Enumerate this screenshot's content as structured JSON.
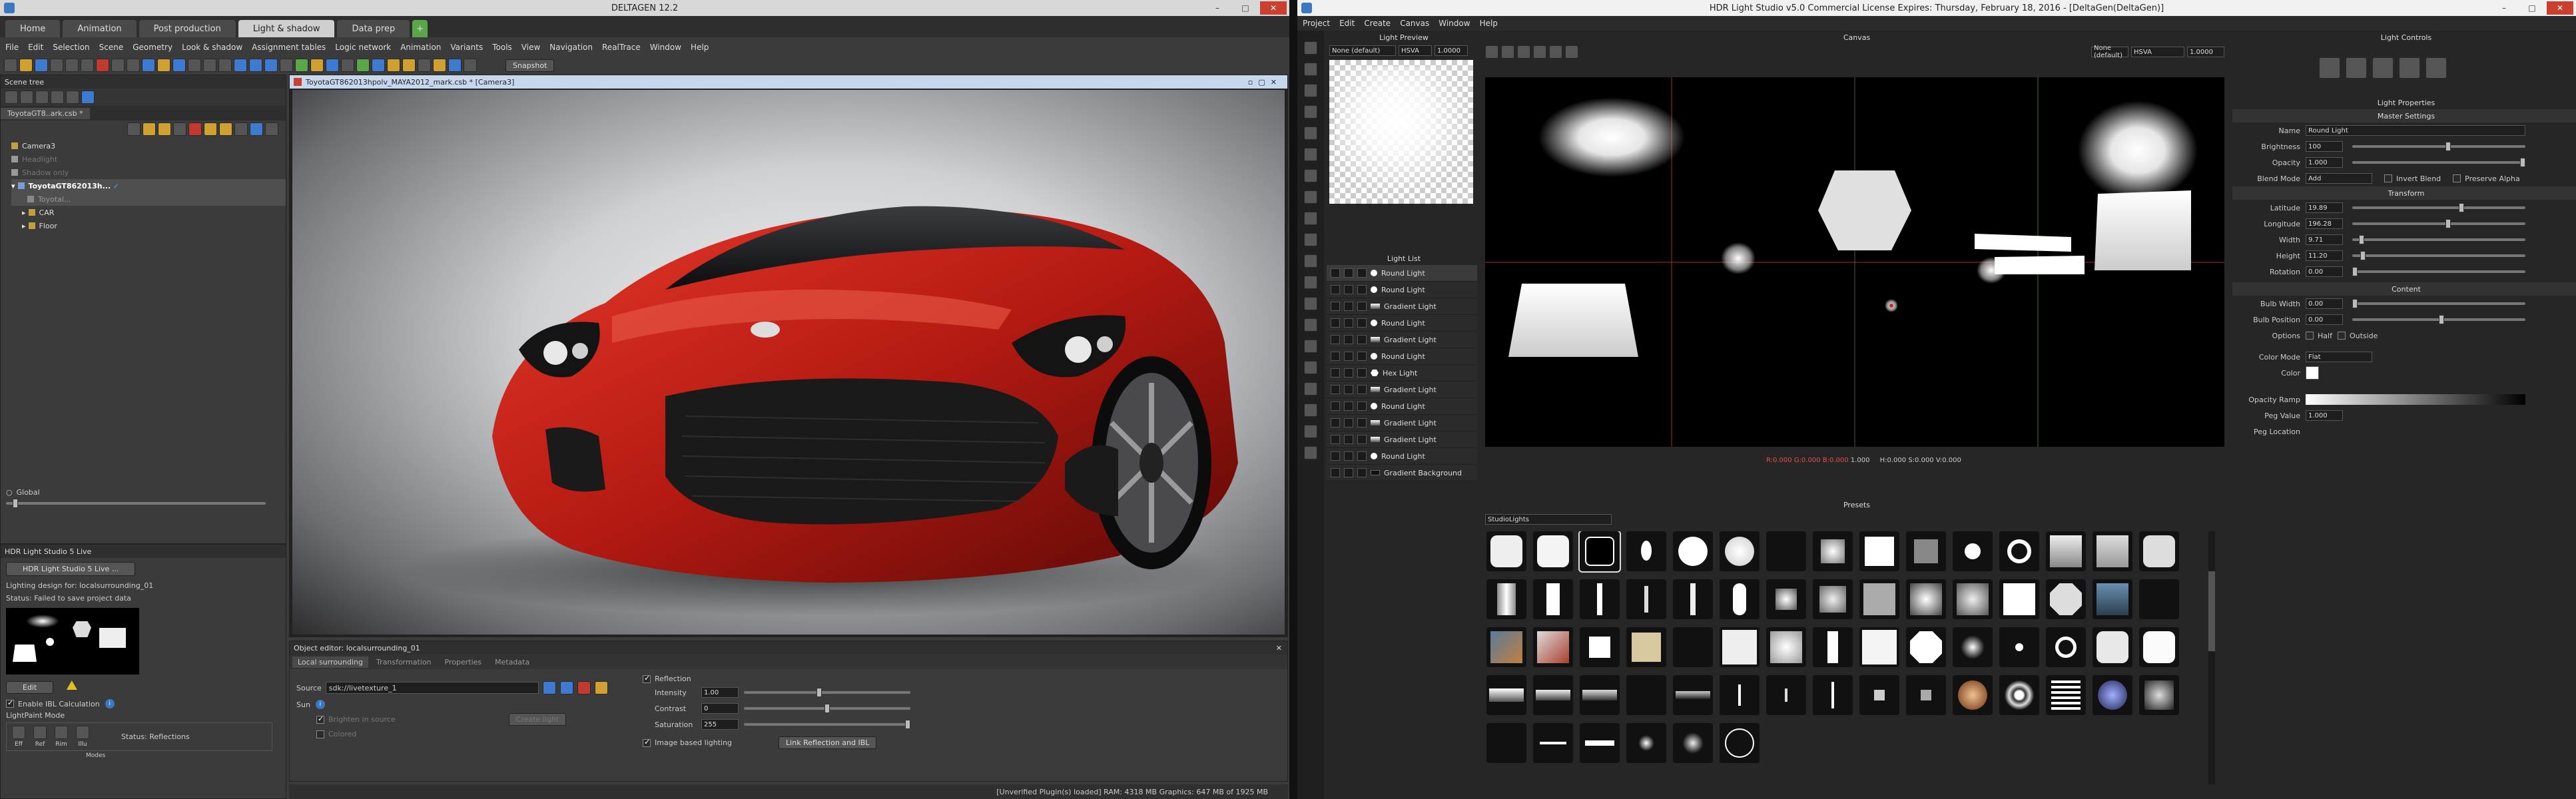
{
  "deltagen": {
    "title": "DELTAGEN 12.2",
    "tabs": [
      "Home",
      "Animation",
      "Post production",
      "Light & shadow",
      "Data prep"
    ],
    "menus": [
      "File",
      "Edit",
      "Selection",
      "Scene",
      "Geometry",
      "Look & shadow",
      "Assignment tables",
      "Logic network",
      "Animation",
      "Variants",
      "Tools",
      "View",
      "Navigation",
      "RealTrace",
      "Window",
      "Help"
    ],
    "snapshot_label": "Snapshot",
    "scene_tree": {
      "header": "Scene tree",
      "file_tab": "ToyotaGT8..ark.csb *",
      "items": [
        "Camera3",
        "Headlight",
        "Shadow only",
        "ToyotaGT862013h...",
        "Toyotal...",
        "CAR",
        "Floor"
      ]
    },
    "global_label": "Global",
    "viewport_title": "ToyotaGT862013hpolv_MAYA2012_mark.csb * [Camera3]",
    "hdr_panel": {
      "header": "HDR Light Studio 5 Live",
      "button": "HDR Light Studio 5 Live ...",
      "design_for": "Lighting design for: localsurrounding_01",
      "status": "Status: Failed to save project data",
      "edit": "Edit",
      "enable_ibl": "Enable IBL Calculation",
      "lightpaint_mode": "LightPaint Mode",
      "modes": [
        "Eff",
        "Ref",
        "Rim",
        "Illu"
      ],
      "status2": "Status: Reflections",
      "modes_footer": "Modes"
    },
    "object_editor": {
      "header": "Object editor: localsurrounding_01",
      "tabs": [
        "Local surrounding",
        "Transformation",
        "Properties",
        "Metadata"
      ],
      "source_label": "Source",
      "source_value": "sdk://livetexture_1",
      "sun_label": "Sun",
      "brighten": "Brighten in source",
      "colored": "Colored",
      "create_light": "Create light",
      "reflection": "Reflection",
      "intensity_label": "Intensity",
      "intensity": "1.00",
      "intensity_level": 0.45,
      "contrast_label": "Contrast",
      "contrast": "0",
      "contrast_level": 0.5,
      "saturation_label": "Saturation",
      "saturation": "255",
      "saturation_level": 1.0,
      "ibl": "Image based lighting",
      "link": "Link Reflection and IBL"
    },
    "statusbar": "[Unverified Plugin(s) loaded]     RAM: 4318 MB Graphics: 647 MB of 1925 MB"
  },
  "hdr": {
    "title": "HDR Light Studio v5.0 Commercial License Expires: Thursday, February 18, 2016 - [DeltaGen(DeltaGen)]",
    "menus": [
      "Project",
      "Edit",
      "Create",
      "Canvas",
      "Window",
      "Help"
    ],
    "preview": {
      "header": "Light Preview",
      "profile": "None (default)",
      "mode": "HSVA",
      "value": "1.0000"
    },
    "light_list": {
      "header": "Light List",
      "items": [
        "Round Light",
        "Round Light",
        "Gradient Light",
        "Round Light",
        "Gradient Light",
        "Round Light",
        "Hex Light",
        "Gradient Light",
        "Round Light",
        "Gradient Light",
        "Gradient Light",
        "Round Light",
        "Gradient Background"
      ]
    },
    "canvas": {
      "header": "Canvas",
      "profile": "None (default)",
      "mode": "HSVA",
      "value": "1.0000",
      "readout_rgb": "R:0.000 G:0.000 B:0.000",
      "readout_a": "1.000",
      "readout_hsv": "H:0.000 S:0.000 V:0.000"
    },
    "presets": {
      "header": "Presets",
      "category": "StudioLights"
    },
    "light_controls": {
      "header": "Light Controls",
      "props_header": "Light Properties",
      "master": "Master Settings",
      "name_label": "Name",
      "name": "Round Light",
      "brightness_label": "Brightness",
      "brightness": "100",
      "opacity_label": "Opacity",
      "opacity": "1.000",
      "blend_label": "Blend Mode",
      "blend": "Add",
      "invert_blend": "Invert Blend",
      "preserve_alpha": "Preserve Alpha",
      "transform": "Transform",
      "latitude_label": "Latitude",
      "latitude": "19.89",
      "longitude_label": "Longitude",
      "longitude": "196.28",
      "width_label": "Width",
      "width": "9.71",
      "height_label": "Height",
      "height": "11.20",
      "rotation_label": "Rotation",
      "rotation": "0.00",
      "content": "Content",
      "bulb_width_label": "Bulb Width",
      "bulb_width": "0.00",
      "bulb_position_label": "Bulb Position",
      "bulb_position": "0.00",
      "options_label": "Options",
      "half": "Half",
      "outside": "Outside",
      "color_mode_label": "Color Mode",
      "color_mode": "Flat",
      "color_label": "Color",
      "opacity_ramp_label": "Opacity Ramp",
      "peg_value_label": "Peg Value",
      "peg_value": "1.000",
      "peg_location_label": "Peg Location"
    }
  },
  "colors": {
    "accent_blue": "#3a78c0",
    "car_red": "#c4221a",
    "alert_red": "#c94030"
  }
}
